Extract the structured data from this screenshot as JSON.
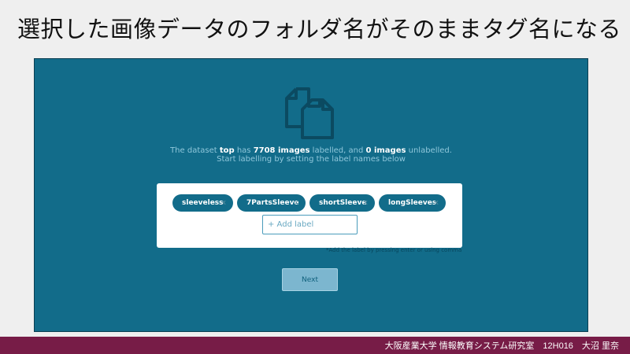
{
  "slide": {
    "title": "選択した画像データのフォルダ名がそのままタグ名になる",
    "footer": "大阪産業大学 情報教育システム研究室　12H016　大沼 里奈"
  },
  "dataset": {
    "line1": [
      "The dataset ",
      "top",
      " has ",
      "7708 images",
      " labelled, and ",
      "0 images",
      " unlabelled."
    ],
    "line2": "Start labelling by setting the label names below"
  },
  "labels": {
    "tags": [
      {
        "name": "sleeveless",
        "remove": "x"
      },
      {
        "name": "7PartsSleeve",
        "remove": "x"
      },
      {
        "name": "shortSleeve",
        "remove": "x"
      },
      {
        "name": "longSleeves",
        "remove": "x"
      }
    ],
    "input_placeholder": "+ Add label",
    "hint": "*Add the label by pressing enter or using comma"
  },
  "actions": {
    "next_label": "Next"
  },
  "colors": {
    "panel": "#126c8a",
    "tag": "#126c8a",
    "button": "#7cb6cf",
    "footer": "#771c47"
  },
  "icons": {
    "dataset": "copy-files-icon"
  }
}
